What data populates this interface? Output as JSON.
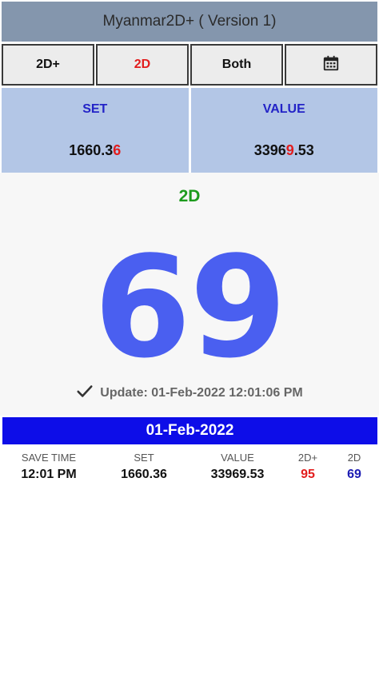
{
  "app": {
    "title": "Myanmar2D+ ( Version 1)"
  },
  "toolbar": {
    "buttons": [
      "2D+",
      "2D",
      "Both"
    ],
    "calendar_icon": "calendar-icon",
    "active_index": 1
  },
  "info": {
    "set_label": "SET",
    "set_value_main": "1660.3",
    "set_value_highlight": "6",
    "value_label": "VALUE",
    "value_value_main": "3396",
    "value_value_highlight": "9",
    "value_value_tail": ".53"
  },
  "result": {
    "mode": "2D",
    "number": "69",
    "update_icon": "check-icon",
    "update_text": "Update: 01-Feb-2022 12:01:06 PM"
  },
  "history": {
    "date": "01-Feb-2022",
    "headers": [
      "SAVE TIME",
      "SET",
      "VALUE",
      "2D+",
      "2D"
    ],
    "rows": [
      {
        "time": "12:01 PM",
        "set": "1660.36",
        "value": "33969.53",
        "twod_plus": "95",
        "twod": "69"
      }
    ]
  },
  "colors": {
    "titlebar": "#8496ad",
    "panel": "#b3c6e6",
    "accent_blue": "#4a5ff0",
    "date_bar": "#0d0de8",
    "highlight_red": "#e21d1d",
    "mode_green": "#1d9b1d"
  }
}
